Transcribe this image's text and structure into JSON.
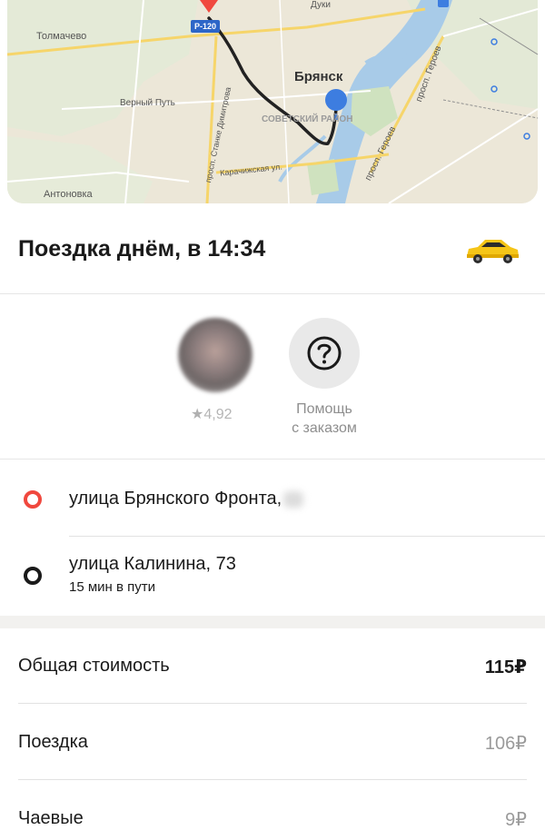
{
  "map": {
    "labels": {
      "tolmachevo": "Толмачево",
      "verny_put": "Верный Путь",
      "antonovka": "Антоновка",
      "bryansk": "Брянск",
      "sovetsky_rayon": "СОВЕТСКИЙ РАЙОН",
      "dimitrova": "просп. Станке Димитрова",
      "karachizhskaya": "Карачижская ул.",
      "geroev_1": "просп. Героев",
      "geroev_2": "просп. Героев",
      "road": "Р-120",
      "duki": "Дуки"
    },
    "colors": {
      "route": "#222222",
      "origin_pin": "#f0483e",
      "destination_pin": "#3d7de0"
    }
  },
  "trip": {
    "title": "Поездка днём, в 14:34",
    "vehicle_icon": "taxi-car-icon"
  },
  "driver": {
    "rating": "4,92"
  },
  "help": {
    "label_line1": "Помощь",
    "label_line2": "с заказом"
  },
  "route": {
    "from": "улица Брянского Фронта,",
    "to": "улица Калинина, 73",
    "duration": "15 мин в пути"
  },
  "cost": {
    "total_label": "Общая стоимость",
    "total_value": "115₽",
    "ride_label": "Поездка",
    "ride_value": "106₽",
    "tips_label": "Чаевые",
    "tips_value": "9₽"
  },
  "accent": {
    "taxi_yellow": "#f5c518",
    "origin_red": "#f0483e"
  }
}
